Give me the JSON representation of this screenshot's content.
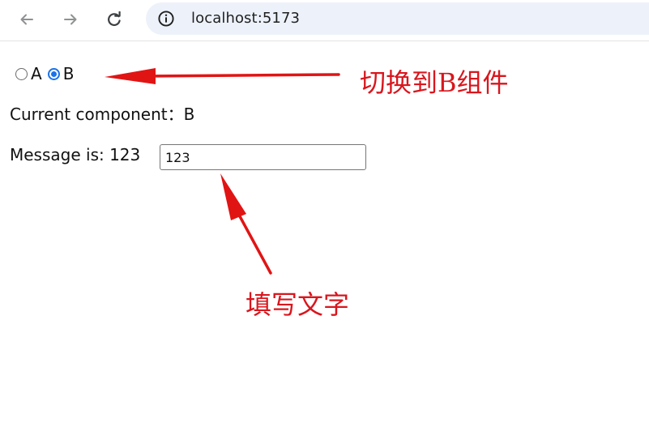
{
  "browser": {
    "url": "localhost:5173",
    "icons": {
      "back": "arrow-back-icon",
      "forward": "arrow-forward-icon",
      "reload": "reload-icon",
      "site_info": "info-icon"
    }
  },
  "radios": [
    {
      "label": "A",
      "checked": false
    },
    {
      "label": "B",
      "checked": true
    }
  ],
  "current": {
    "text": "Current component：B"
  },
  "message": {
    "text": "Message is: 123",
    "input_value": "123"
  },
  "annotations": {
    "switch_note": "切换到B组件",
    "fill_note": "填写文字",
    "color": "#d9161d"
  },
  "colors": {
    "accent": "#1a73e8",
    "omnibox_bg": "#edf2fa"
  }
}
